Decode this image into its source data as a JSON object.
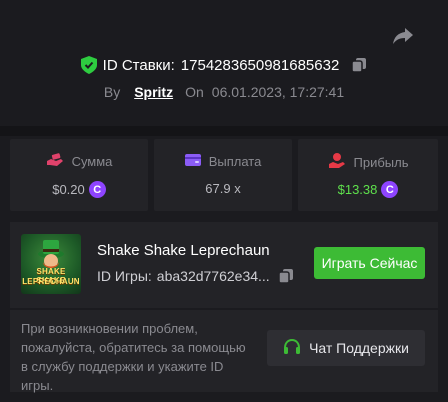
{
  "bet": {
    "id_label": "ID Ставки:",
    "id_value": "1754283650981685632",
    "by_label": "By",
    "user": "Spritz",
    "on_label": "On",
    "date": "06.01.2023, 17:27:41"
  },
  "stats": {
    "amount": {
      "label": "Сумма",
      "value": "$0.20"
    },
    "payout": {
      "label": "Выплата",
      "value": "67.9 x"
    },
    "profit": {
      "label": "Прибыль",
      "value": "$13.38"
    }
  },
  "coin_symbol": "C",
  "game": {
    "title": "Shake Shake Leprechaun",
    "thumb_line1": "SHAKE SHAKE",
    "thumb_line2": "LEPRECHAUN",
    "id_label": "ID Игры:",
    "id_value": "aba32d7762e34...",
    "play_label": "Играть Сейчас"
  },
  "help": {
    "text": "При возникновении проблем, пожалуйста, обратитесь за помощью в службу поддержки и укажите ID игры.",
    "chat_label": "Чат Поддержки"
  },
  "colors": {
    "background": "#1b1b1f",
    "panel": "#232327",
    "accent_green": "#3dbb35",
    "profit_green": "#5ee04c",
    "coin_purple": "#8e44ff",
    "amount_icon": "#e0426b",
    "payout_icon": "#8b5cf6",
    "profit_icon": "#e63946"
  },
  "icons": {
    "share": "share-arrow-icon",
    "shield": "shield-check-icon",
    "copy": "copy-icon",
    "amount": "money-hand-icon",
    "payout": "wallet-icon",
    "profit": "profit-hand-icon",
    "chat": "headset-icon",
    "coin": "coin-icon"
  }
}
